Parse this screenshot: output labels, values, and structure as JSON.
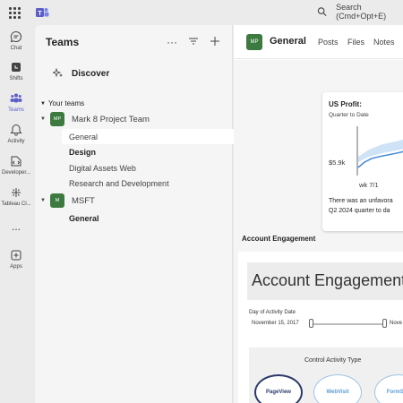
{
  "topbar": {
    "search_placeholder": "Search (Cmd+Opt+E)"
  },
  "rail": {
    "items": [
      {
        "label": "Chat",
        "icon": "chat-icon"
      },
      {
        "label": "Shifts",
        "icon": "shifts-icon"
      },
      {
        "label": "Teams",
        "icon": "teams-icon"
      },
      {
        "label": "Activity",
        "icon": "bell-icon"
      },
      {
        "label": "Developer...",
        "icon": "developer-icon"
      },
      {
        "label": "Tableau Cl...",
        "icon": "tableau-icon"
      },
      {
        "label": "...",
        "icon": "more-icon"
      },
      {
        "label": "Apps",
        "icon": "apps-icon"
      }
    ]
  },
  "panel": {
    "title": "Teams",
    "more": "···",
    "discover": "Discover",
    "section": "Your teams",
    "teams": [
      {
        "initials": "MP",
        "name": "Mark 8 Project Team",
        "channels": [
          "General",
          "Design",
          "Digital Assets Web",
          "Research and Development"
        ]
      },
      {
        "initials": "M",
        "name": "MSFT",
        "channels": [
          "General"
        ]
      }
    ]
  },
  "main": {
    "initials": "MP",
    "channel": "General",
    "tabs": [
      "Posts",
      "Files",
      "Notes"
    ],
    "card": {
      "title": "US Profit:",
      "subtitle": "Quarter to Date",
      "y_label": "$5.9k",
      "x_label": "wk 7/1",
      "text_line1": "There was an unfavora",
      "text_line2": "Q2 2024 quarter to da"
    },
    "section_label": "Account Engagement",
    "embed": {
      "banner": "Account Engagement",
      "date_label": "Day of Activity Date",
      "date_start": "November 15, 2017",
      "date_end": "Nove",
      "activity_title": "Control Activity Type",
      "activity_types": [
        "PageView",
        "WebVisit",
        "FormSub"
      ]
    }
  },
  "colors": {
    "accent": "#5b5fc7",
    "team_avatar": "#3c7a3f",
    "chart_line": "#4a8fd6",
    "chart_band": "#cfe3f6"
  }
}
